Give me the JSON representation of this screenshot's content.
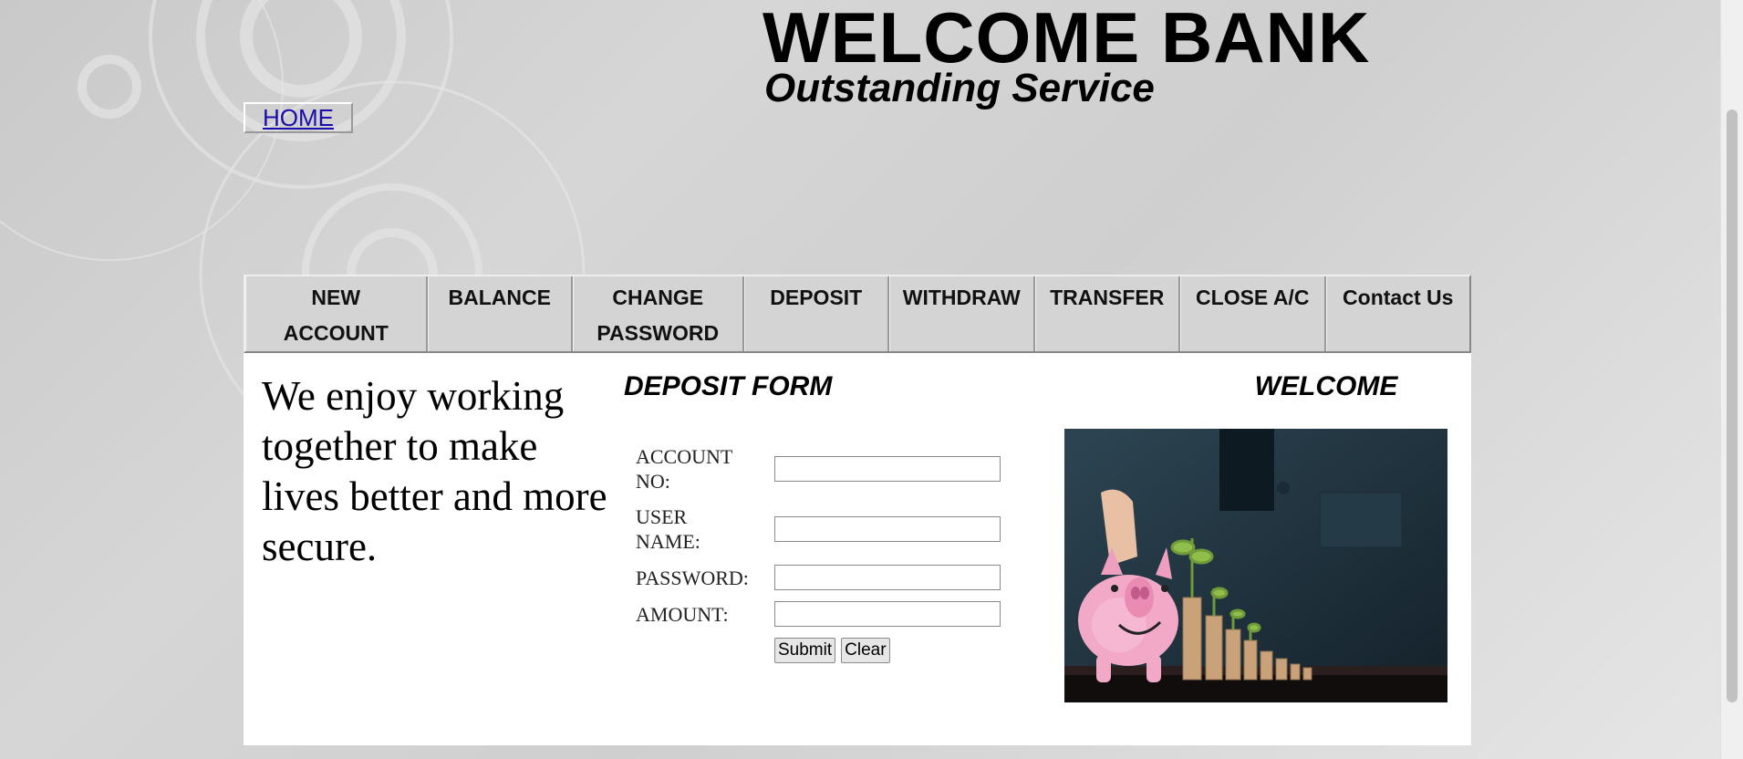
{
  "header": {
    "title": "WELCOME BANK",
    "subtitle": "Outstanding Service"
  },
  "home_link": "HOME",
  "nav": {
    "items": [
      {
        "label": "NEW ACCOUNT"
      },
      {
        "label": "BALANCE"
      },
      {
        "label": "CHANGE PASSWORD"
      },
      {
        "label": "DEPOSIT"
      },
      {
        "label": "WITHDRAW"
      },
      {
        "label": "TRANSFER"
      },
      {
        "label": "CLOSE A/C"
      },
      {
        "label": "Contact Us"
      }
    ]
  },
  "tagline": "We enjoy working together to make lives better and more secure.",
  "deposit_form": {
    "title": "DEPOSIT FORM",
    "fields": [
      {
        "label": "ACCOUNT NO:",
        "value": ""
      },
      {
        "label": "USER NAME:",
        "value": ""
      },
      {
        "label": "PASSWORD:",
        "value": ""
      },
      {
        "label": "AMOUNT:",
        "value": ""
      }
    ],
    "submit_label": "Submit",
    "clear_label": "Clear"
  },
  "welcome_label": "WELCOME",
  "image": {
    "subject": "piggy-bank-with-coin-stacks"
  }
}
